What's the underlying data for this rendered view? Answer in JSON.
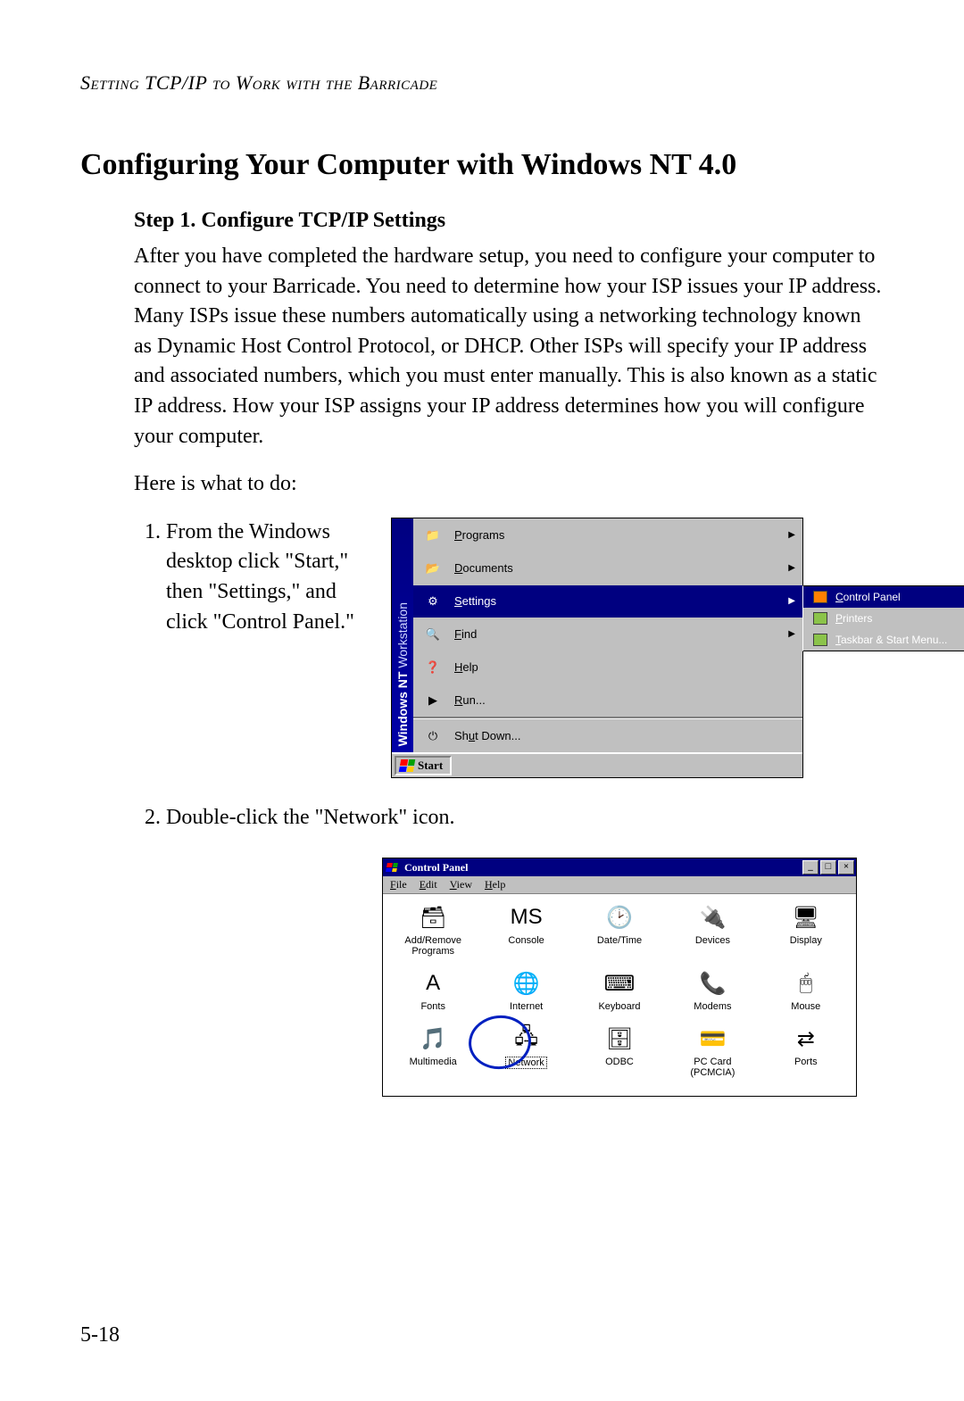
{
  "running_head": "Setting TCP/IP to Work with the Barricade",
  "title": "Configuring Your Computer with Windows NT 4.0",
  "step_heading": "Step 1. Configure TCP/IP Settings",
  "intro_para": "After you have completed the hardware setup, you need to configure your computer to connect to your Barricade. You need to determine how your ISP issues your IP address. Many ISPs issue these numbers automatically using a networking technology known as Dynamic Host Control Protocol, or DHCP. Other ISPs will specify your IP address and associated numbers, which you must enter manually. This is also known as a static IP address. How your ISP assigns your IP address determines how you will configure your computer.",
  "lead_in": "Here is what to do:",
  "step1_text": "From the Windows desktop click \"Start,\" then \"Settings,\" and click \"Control Panel.\"",
  "step2_text": "Double-click the \"Network\" icon.",
  "page_number": "5-18",
  "start_menu": {
    "os_banner_bold": "Windows NT",
    "os_banner_light": " Workstation",
    "items": [
      {
        "label": "Programs",
        "accel": "P",
        "arrow": true
      },
      {
        "label": "Documents",
        "accel": "D",
        "arrow": true
      },
      {
        "label": "Settings",
        "accel": "S",
        "arrow": true,
        "highlight": true
      },
      {
        "label": "Find",
        "accel": "F",
        "arrow": true
      },
      {
        "label": "Help",
        "accel": "H",
        "arrow": false
      },
      {
        "label": "Run...",
        "accel": "R",
        "arrow": false
      },
      {
        "label": "Shut Down...",
        "accel": "u",
        "arrow": false
      }
    ],
    "submenu": [
      {
        "label": "Control Panel",
        "accel": "C",
        "highlight": true
      },
      {
        "label": "Printers",
        "accel": "P"
      },
      {
        "label": "Taskbar & Start Menu...",
        "accel": "T"
      }
    ],
    "start_button": "Start"
  },
  "control_panel": {
    "title": "Control Panel",
    "menus": [
      "File",
      "Edit",
      "View",
      "Help"
    ],
    "menu_accels": [
      "F",
      "E",
      "V",
      "H"
    ],
    "win_buttons": [
      "_",
      "□",
      "×"
    ],
    "icons": [
      {
        "label": "Add/Remove\nPrograms"
      },
      {
        "label": "Console"
      },
      {
        "label": "Date/Time"
      },
      {
        "label": "Devices"
      },
      {
        "label": "Display"
      },
      {
        "label": "Fonts"
      },
      {
        "label": "Internet"
      },
      {
        "label": "Keyboard"
      },
      {
        "label": "Modems"
      },
      {
        "label": "Mouse"
      },
      {
        "label": "Multimedia"
      },
      {
        "label": "Network",
        "selected": true,
        "ring": true
      },
      {
        "label": "ODBC"
      },
      {
        "label": "PC Card\n(PCMCIA)"
      },
      {
        "label": "Ports"
      }
    ]
  }
}
